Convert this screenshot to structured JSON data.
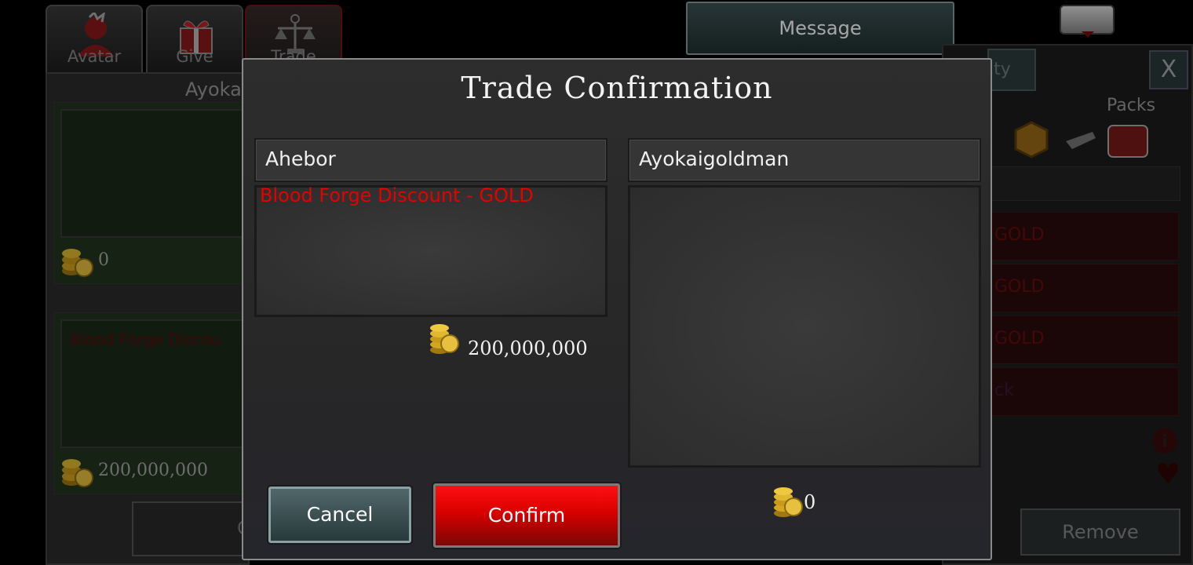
{
  "tabs": [
    {
      "label": "Avatar",
      "icon": "avatar-icon"
    },
    {
      "label": "Give",
      "icon": "gift-icon"
    },
    {
      "label": "Trade",
      "icon": "scales-icon"
    }
  ],
  "background": {
    "left_panel_header": "Ayoka",
    "top_gold": "0",
    "item_partial": "Blood Forge Discou",
    "bottom_gold": "200,000,000",
    "bottom_button_partial": "C",
    "message_button": "Message",
    "right_tab_partial": "ity",
    "close_label": "X",
    "packs_label": "Packs",
    "right_rows": [
      "GOLD",
      "GOLD",
      "GOLD",
      "ck"
    ],
    "remove_button": "Remove"
  },
  "modal": {
    "title": "Trade Confirmation",
    "left": {
      "player": "Ahebor",
      "items": [
        "Blood Forge Discount - GOLD"
      ],
      "gold": "200,000,000"
    },
    "right": {
      "player": "Ayokaigoldman",
      "items": [],
      "gold": "0"
    },
    "cancel_label": "Cancel",
    "confirm_label": "Confirm"
  },
  "colors": {
    "accent_red": "#e60000",
    "confirm_button": "#d80000",
    "cancel_button": "#3e5254"
  }
}
